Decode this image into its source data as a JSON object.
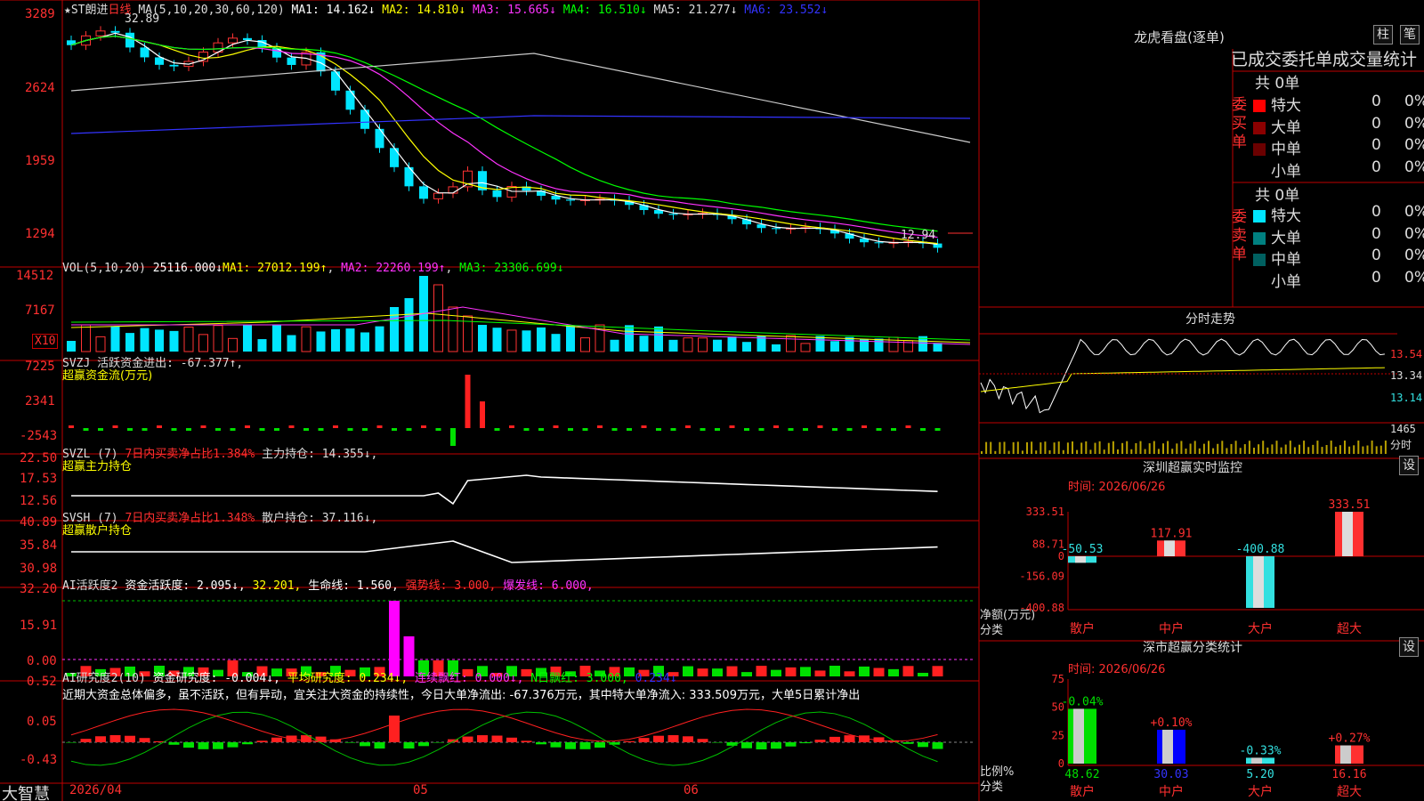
{
  "app": {
    "brand": "大智慧"
  },
  "main_chart": {
    "symbol": "★ST朗进",
    "period": "日线",
    "ma_label": "MA(5,10,20,30,60,120)",
    "ma1": "MA1: 14.162↓",
    "ma2": "MA2: 14.810↓",
    "ma3": "MA3: 15.665↓",
    "ma4": "MA4: 16.510↓",
    "ma5": "MA5: 21.277↓",
    "ma6": "MA6: 23.552↓",
    "high_note": "32.89",
    "low_note": "12.94",
    "y_ticks": [
      "3289",
      "2624",
      "1959",
      "1294"
    ],
    "colors": {
      "up": "#ff3333",
      "down": "#00e5ff",
      "ma1": "#ffffff",
      "ma2": "#ffff00",
      "ma3": "#ff33ff",
      "ma4": "#00ff00",
      "ma5": "#cccccc",
      "ma6": "#3333ff"
    }
  },
  "vol_panel": {
    "label": "VOL(5,10,20)",
    "value": "25116.000↓",
    "ma1": "MA1: 27012.199↑",
    "ma2": "MA2: 22260.199↑",
    "ma3": "MA3: 23306.699↓",
    "y_ticks": [
      "14512",
      "7167"
    ],
    "multiplier": "X10"
  },
  "svzj_panel": {
    "label": "SVZJ",
    "text": "活跃资金进出: -67.377↑,",
    "subtitle": "超赢资金流(万元)",
    "y_ticks": [
      "7225",
      "2341",
      "-2543"
    ]
  },
  "svzl_panel": {
    "label": "SVZL (7)",
    "text1": "7日内买卖净占比1.384%",
    "text2": "主力持仓: 14.355↓,",
    "subtitle": "超赢主力持仓",
    "y_ticks": [
      "22.50",
      "17.53",
      "12.56"
    ]
  },
  "svsh_panel": {
    "label": "SVSH (7)",
    "text1": "7日内买卖净占比1.348%",
    "text2": "散户持仓: 37.116↓,",
    "subtitle": "超赢散户持仓",
    "y_ticks": [
      "40.89",
      "35.84",
      "30.98"
    ]
  },
  "ai_active_panel": {
    "label": "AI活跃度2",
    "t1": "资金活跃度: 2.095↓,",
    "t2": "32.201,",
    "t3": "生命线: 1.560,",
    "t4": "强势线: 3.000,",
    "t5": "爆发线: 6.000,",
    "y_ticks": [
      "32.20",
      "15.91",
      "0.00"
    ]
  },
  "ai_research_panel": {
    "label": "AI研究度2(10)",
    "t1": "资金研究度: -0.004↓,",
    "t2": "平均研究度: 0.234↓,",
    "t3": "连续飘红: 0.000↓,",
    "t4": "N日飘红: 3.000,",
    "t5": "0.234↓",
    "commentary": "近期大资金总体偏多，虽不活跃，但有异动，宜关注大资金的持续性，今日大单净流出: -67.376万元，其中特大单净流入: 333.509万元，大单5日累计净出",
    "y_ticks": [
      "0.52",
      "0.05",
      "-0.43"
    ]
  },
  "x_axis": {
    "labels": [
      "2026/04",
      "05",
      "06"
    ]
  },
  "dragon_tiger": {
    "title": "龙虎看盘(逐单)",
    "btn_bar": "柱",
    "btn_tick": "笔",
    "header": "已成交委托单成交量统计",
    "buy_side": "委买单",
    "sell_side": "委卖单",
    "buy_total": "共 0单",
    "sell_total": "共 0单",
    "buy_rows": [
      {
        "name": "特大",
        "count": "0",
        "pct": "0%",
        "color": "#ff0000"
      },
      {
        "name": "大单",
        "count": "0",
        "pct": "0%",
        "color": "#8b0000"
      },
      {
        "name": "中单",
        "count": "0",
        "pct": "0%",
        "color": "#6b0000"
      },
      {
        "name": "小单",
        "count": "0",
        "pct": "0%",
        "color": "#000000"
      }
    ],
    "sell_rows": [
      {
        "name": "特大",
        "count": "0",
        "pct": "0%",
        "color": "#00e5ff"
      },
      {
        "name": "大单",
        "count": "0",
        "pct": "0%",
        "color": "#008080"
      },
      {
        "name": "中单",
        "count": "0",
        "pct": "0%",
        "color": "#006060"
      },
      {
        "name": "小单",
        "count": "0",
        "pct": "0%",
        "color": "#000000"
      }
    ]
  },
  "intraday": {
    "title": "分时走势",
    "y_ticks": [
      "13.54",
      "13.34",
      "13.14"
    ],
    "vol_tick": "1465",
    "vol_label": "分时"
  },
  "sz_monitor": {
    "title": "深圳超赢实时监控",
    "btn": "设",
    "time": "时间: 2026/06/26",
    "y_ticks": [
      "333.51",
      "88.71",
      "0",
      "-156.09",
      "-400.88"
    ],
    "y_label": "净额(万元)",
    "cat_label": "分类",
    "categories": [
      "散户",
      "中户",
      "大户",
      "超大"
    ],
    "values": [
      -50.53,
      117.91,
      -400.88,
      333.51
    ],
    "value_labels": [
      "-50.53",
      "117.91",
      "-400.88",
      "333.51"
    ]
  },
  "sz_category": {
    "title": "深市超赢分类统计",
    "btn": "设",
    "time": "时间: 2026/06/26",
    "y_ticks": [
      "75",
      "50",
      "25",
      "0"
    ],
    "y_label": "比例%",
    "cat_label": "分类",
    "categories": [
      "散户",
      "中户",
      "大户",
      "超大"
    ],
    "values": [
      48.62,
      30.03,
      5.2,
      16.16
    ],
    "value_labels": [
      "48.62",
      "30.03",
      "5.20",
      "16.16"
    ],
    "changes": [
      "-0.04%",
      "+0.10%",
      "-0.33%",
      "+0.27%"
    ]
  },
  "chart_data": {
    "type": "bar",
    "title": "深圳超赢实时监控",
    "categories": [
      "散户",
      "中户",
      "大户",
      "超大"
    ],
    "series": [
      {
        "values": [
          -50.53,
          117.91,
          -400.88,
          333.51
        ]
      }
    ],
    "ylabel": "净额(万元)",
    "ylim": [
      -400.88,
      333.51
    ],
    "price": {
      "type": "candlestick",
      "high": 32.89,
      "low": 12.94,
      "ma": {
        "MA1": 14.162,
        "MA2": 14.81,
        "MA3": 15.665,
        "MA4": 16.51,
        "MA5": 21.277,
        "MA6": 23.552
      }
    }
  }
}
